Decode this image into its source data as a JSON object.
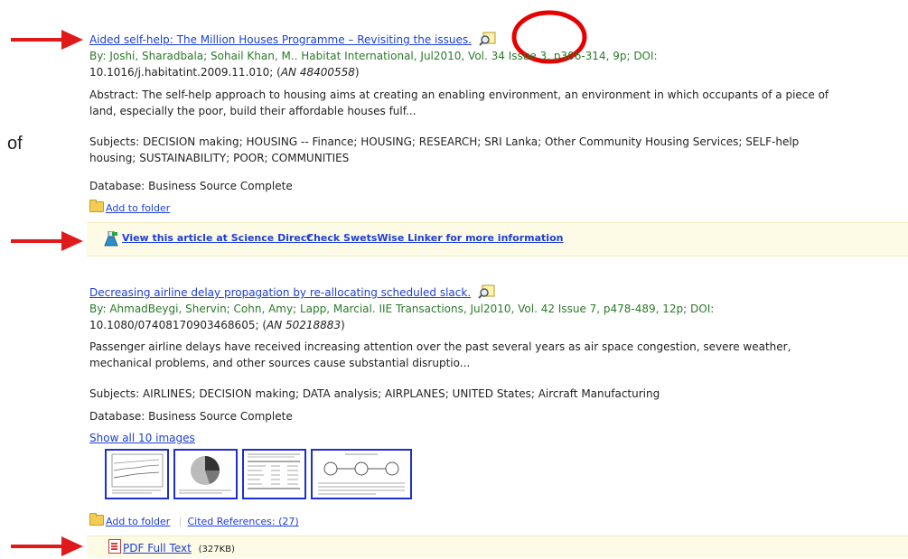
{
  "side_label": "of",
  "results": [
    {
      "title": "Aided self-help: The Million Houses Programme – Revisiting the issues.",
      "byline": "By: Joshi, Sharadbala; Sohail Khan, M.. Habitat International, Jul2010, Vol. 34 Issue 3, p306-314, 9p; DOI:",
      "doi_line_a": "10.1016/j.habitatint.2009.11.010; (",
      "an": "AN 48400558",
      "doi_line_b": ")",
      "abstract_1": "Abstract: The self-help approach to housing aims at creating an enabling environment, an environment in which occupants of a piece of",
      "abstract_2": "land, especially the poor, build their affordable houses fulf...",
      "subjects_1": "Subjects: DECISION making; HOUSING -- Finance; HOUSING; RESEARCH; SRI Lanka; Other Community Housing Services; SELF-help",
      "subjects_2": "housing; SUSTAINABILITY; POOR; COMMUNITIES",
      "database": "Database: Business Source Complete",
      "add_to_folder": "Add to folder",
      "link_science_direct": "View this article at Science Direct",
      "link_swetswise": "Check SwetsWise Linker for more information"
    },
    {
      "title": "Decreasing airline delay propagation by re-allocating scheduled slack.",
      "byline": "By: AhmadBeygi, Shervin; Cohn, Amy; Lapp, Marcial. IIE Transactions, Jul2010, Vol. 42 Issue 7, p478-489, 12p; DOI:",
      "doi_line_a": "10.1080/07408170903468605; (",
      "an": "AN 50218883",
      "doi_line_b": ")",
      "abstract_1": "Passenger airline delays have received increasing attention over the past several years as air space congestion, severe weather,",
      "abstract_2": "mechanical problems, and other sources cause substantial disruptio...",
      "subjects": "Subjects: AIRLINES; DECISION making; DATA analysis; AIRPLANES; UNITED States; Aircraft Manufacturing",
      "database": "Database: Business Source Complete",
      "show_images": "Show all 10 images",
      "add_to_folder": "Add to folder",
      "cited_refs": "Cited References: (27)",
      "pdf_full_text": "PDF Full Text",
      "pdf_size": "(327KB)"
    }
  ],
  "icons": {
    "arrow": "red-arrow-icon",
    "preview": "magnifier-preview-icon",
    "folder": "folder-icon",
    "flask": "flask-icon",
    "pdf": "pdf-icon"
  },
  "colors": {
    "link": "#1d3fd6",
    "source_green": "#2a7a2a",
    "arrow_red": "#e01a1a",
    "highlight_bar": "#fdfbe6",
    "thumb_border": "#1d2fd0"
  }
}
